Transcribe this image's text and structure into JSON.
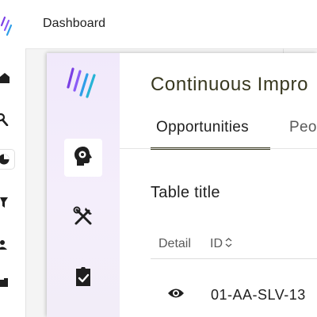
{
  "header": {
    "title": "Dashboard"
  },
  "outer_nav": [
    {
      "name": "home-icon"
    },
    {
      "name": "search-icon"
    },
    {
      "name": "pie-chart-icon",
      "active": true
    },
    {
      "name": "filter-icon"
    },
    {
      "name": "people-icon"
    },
    {
      "name": "folder-icon"
    }
  ],
  "inner_nav": [
    {
      "name": "head-gear-icon",
      "active": true
    },
    {
      "name": "tools-icon"
    },
    {
      "name": "clipboard-check-icon"
    }
  ],
  "page": {
    "title": "Continuous Impro"
  },
  "tabs": [
    {
      "label": "Opportunities",
      "active": true
    },
    {
      "label": "Peo"
    }
  ],
  "table": {
    "title": "Table title",
    "columns": [
      "Detail",
      "ID"
    ],
    "rows": [
      {
        "detail_icon": "eye-icon",
        "id": "01-AA-SLV-13"
      }
    ]
  },
  "colors": {
    "logo": [
      "#7b3fe4",
      "#8b5cf6",
      "#2f9ee8",
      "#27b3d6"
    ],
    "title_text": "#38381f",
    "rail_bg": "#f2ebfb"
  }
}
